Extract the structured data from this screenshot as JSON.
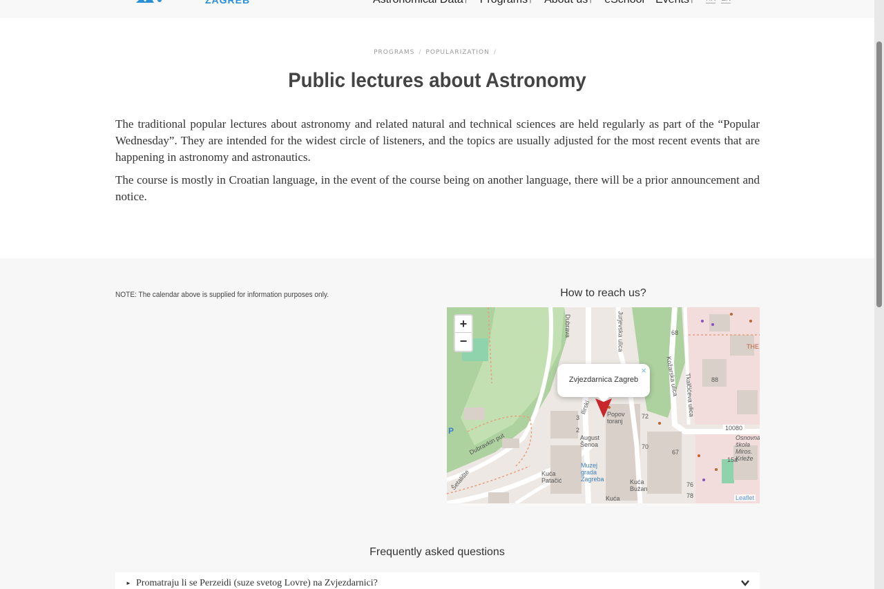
{
  "header": {
    "logo_text": "ZAGREB",
    "nav": [
      "Astronomical Data↑",
      "Programs↑",
      "About us↑",
      "eSchool",
      "Events↑"
    ],
    "lang": [
      "HR",
      "EN"
    ]
  },
  "breadcrumb": [
    "PROGRAMS",
    "POPULARIZATION"
  ],
  "page": {
    "title": "Public lectures about Astronomy",
    "paragraphs": [
      "The traditional popular lectures about astronomy and related natural and technical sciences are held regularly as part of the “Popular Wednesday”. They are intended for the widest circle of listeners, and the topics are usually adjusted for the most recent events that are happening in astronomy and astronautics.",
      "The course is mostly in Croatian language, in the event of the course being on another language, there will be a prior announcement and notice."
    ]
  },
  "note": "NOTE: The calendar above is supplied for information purposes only.",
  "map": {
    "title": "How to reach us?",
    "zoom_in": "+",
    "zoom_out": "−",
    "popup": "Zvjezdarnica Zagreb",
    "popup_close": "×",
    "attribution": "Leaflet",
    "labels": {
      "dubravkin": "Dubravkin put",
      "jurjevska": "Jurjevska ulica",
      "kozarska": "Kožarska ulica",
      "tkalciceva": "Tkalčićeva ulica",
      "ilirski": "Ilirski",
      "popov": "Popov toranj",
      "august": "August Šenoa",
      "muzej1": "Muzej grada Zagreba",
      "kuca_patacic": "Kuća Patačić",
      "kuca_buzan": "Kuća Bužan",
      "kuca": "Kuća",
      "zip": "10080",
      "osnovna": "Osnovna škola Miros. Krleže",
      "setaliste": "Šetalište",
      "dubrava": "Dubrava",
      "the": "THE",
      "num68": "68",
      "num88": "88",
      "num72": "72",
      "num70": "70",
      "num67": "67",
      "num15a": "15a",
      "num76": "76",
      "num78": "78",
      "num3": "3",
      "num2": "2",
      "p": "P"
    }
  },
  "faq": {
    "title": "Frequently asked questions",
    "items": [
      "Promatraju li se Perzeidi (suze svetog Lovre) na Zvjezdarnici?"
    ]
  }
}
